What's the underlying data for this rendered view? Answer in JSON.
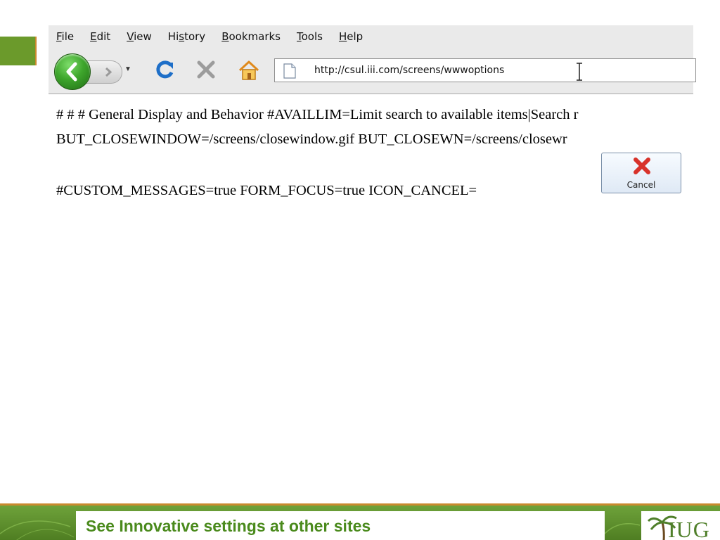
{
  "menu": {
    "items": [
      {
        "pre": "",
        "ul": "F",
        "post": "ile"
      },
      {
        "pre": "",
        "ul": "E",
        "post": "dit"
      },
      {
        "pre": "",
        "ul": "V",
        "post": "iew"
      },
      {
        "pre": "Hi",
        "ul": "s",
        "post": "tory"
      },
      {
        "pre": "",
        "ul": "B",
        "post": "ookmarks"
      },
      {
        "pre": "",
        "ul": "T",
        "post": "ools"
      },
      {
        "pre": "",
        "ul": "H",
        "post": "elp"
      }
    ]
  },
  "address_bar": {
    "url": "http://csul.iii.com/screens/wwwoptions"
  },
  "content": {
    "line1": "# # # General Display and Behavior #AVAILLIM=Limit search to available items|Search r",
    "line2": "BUT_CLOSEWINDOW=/screens/closewindow.gif BUT_CLOSEWN=/screens/closewr",
    "line3": "#CUSTOM_MESSAGES=true FORM_FOCUS=true ICON_CANCEL="
  },
  "cancel_button": {
    "label": "Cancel"
  },
  "footer": {
    "text": "See Innovative settings at other sites",
    "logo_text": "IUG"
  },
  "colors": {
    "accent_green": "#6b9a2b",
    "accent_orange": "#c98a2e",
    "footer_text_green": "#4a8a1c"
  },
  "icons": [
    "back-arrow-icon",
    "forward-arrow-icon",
    "reload-icon",
    "stop-icon",
    "home-icon",
    "page-icon",
    "text-cursor-icon",
    "cancel-x-icon",
    "palm-tree-icon"
  ]
}
